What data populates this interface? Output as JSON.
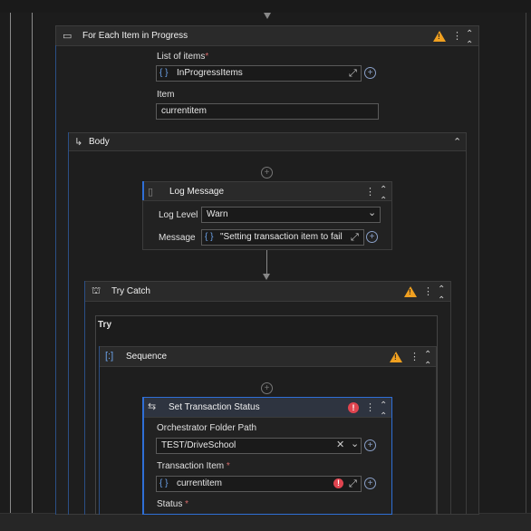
{
  "app": {
    "accent": "#2f6fd6",
    "warning_color": "#f0a020",
    "error_color": "#e0444f"
  },
  "for_each": {
    "title": "For Each Item in Progress",
    "list_label": "List of items",
    "list_required": "*",
    "list_value": "InProgressItems",
    "item_label": "Item",
    "item_value": "currentitem"
  },
  "body_block": {
    "title": "Body"
  },
  "log_message": {
    "title": "Log Message",
    "level_label": "Log Level",
    "level_value": "Warn",
    "message_label": "Message",
    "message_value": "\"Setting transaction item to fail"
  },
  "try_catch": {
    "title": "Try Catch",
    "try_label": "Try"
  },
  "sequence": {
    "title": "Sequence"
  },
  "set_status": {
    "title": "Set Transaction Status",
    "folder_label": "Orchestrator Folder Path",
    "folder_value": "TEST/DriveSchool",
    "transaction_label": "Transaction Item",
    "transaction_required": "*",
    "transaction_value": "currentitem",
    "status_label": "Status",
    "status_required": "*"
  },
  "icons": {
    "curly": "{ }",
    "plus": "+",
    "expand": "⤢",
    "clear": "✕",
    "dropdown": "⌄",
    "collapse": "⌃",
    "more": "⋮",
    "warning": "!",
    "error": "!"
  }
}
